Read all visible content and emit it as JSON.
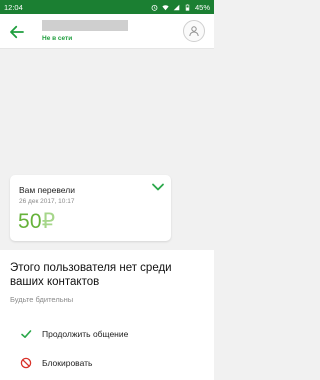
{
  "status_bar": {
    "time": "12:04",
    "battery": "45%",
    "icons": [
      "alarm-icon",
      "wifi-icon",
      "signal-icon",
      "battery-icon"
    ]
  },
  "app_bar": {
    "contact_status": "Не в сети",
    "icons": [
      "back-arrow-icon",
      "person-icon"
    ]
  },
  "transfer": {
    "title": "Вам перевели",
    "date": "26 дек 2017, 10:17",
    "amount": "50",
    "currency": "₽"
  },
  "warning": {
    "title": "Этого пользователя нет среди ваших контактов",
    "subtitle": "Будьте бдительны",
    "actions": [
      {
        "label": "Продолжить общение",
        "icon": "check-icon"
      },
      {
        "label": "Блокировать",
        "icon": "block-icon"
      }
    ]
  },
  "colors": {
    "status_bar": "#1b7f32",
    "accent_green": "#1f9e3e",
    "amount_green": "#66b23a",
    "block_red": "#d9322a"
  }
}
